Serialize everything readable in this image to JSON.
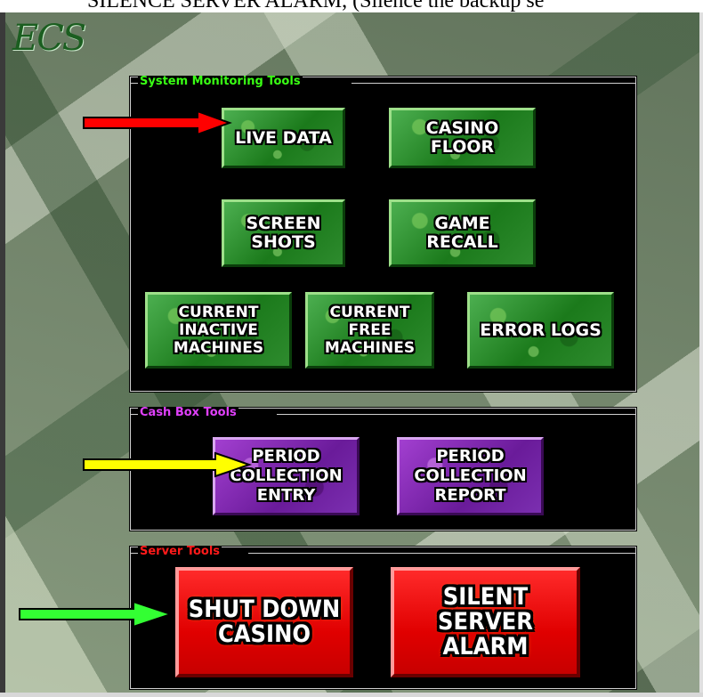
{
  "top_caption": "SILENCE SERVER ALARM, (Silence the backup se",
  "logo": "ECS",
  "panels": {
    "monitoring": {
      "title": "System Monitoring Tools",
      "title_color": "#39ff14",
      "buttons": {
        "live_data": "LIVE DATA",
        "casino_floor": "CASINO\nFLOOR",
        "screen_shots": "SCREEN\nSHOTS",
        "game_recall": "GAME\nRECALL",
        "current_inactive": "CURRENT\nINACTIVE\nMACHINES",
        "current_free": "CURRENT\nFREE\nMACHINES",
        "error_logs": "ERROR LOGS"
      }
    },
    "cashbox": {
      "title": "Cash Box Tools",
      "title_color": "#e040fb",
      "buttons": {
        "period_entry": "PERIOD\nCOLLECTION\nENTRY",
        "period_report": "PERIOD\nCOLLECTION\nREPORT"
      }
    },
    "server": {
      "title": "Server Tools",
      "title_color": "#ff1a1a",
      "buttons": {
        "shut_down": "SHUT DOWN\nCASINO",
        "silent_alarm": "SILENT SERVER\nALARM"
      }
    }
  },
  "arrows": {
    "red": "#ff0000",
    "yellow": "#ffff00",
    "green": "#33ff33"
  }
}
